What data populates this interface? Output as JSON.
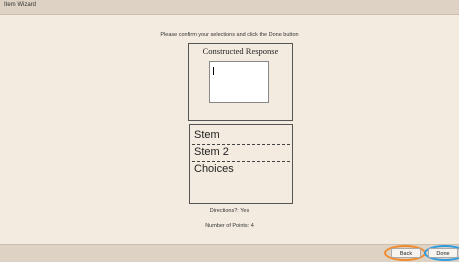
{
  "window": {
    "title": "Item Wizard"
  },
  "instruction": "Please confirm your selections and click the Done button",
  "preview": {
    "heading": "Constructed Response"
  },
  "parts": [
    {
      "label": "Stem"
    },
    {
      "label": "Stem 2"
    },
    {
      "label": "Choices"
    }
  ],
  "summary": {
    "directions": "Directions?: Yes",
    "points": "Number of Points: 4"
  },
  "buttons": {
    "back": "Back",
    "done": "Done"
  },
  "colors": {
    "highlight_back": "#f08a2c",
    "highlight_done": "#2f9be0"
  }
}
